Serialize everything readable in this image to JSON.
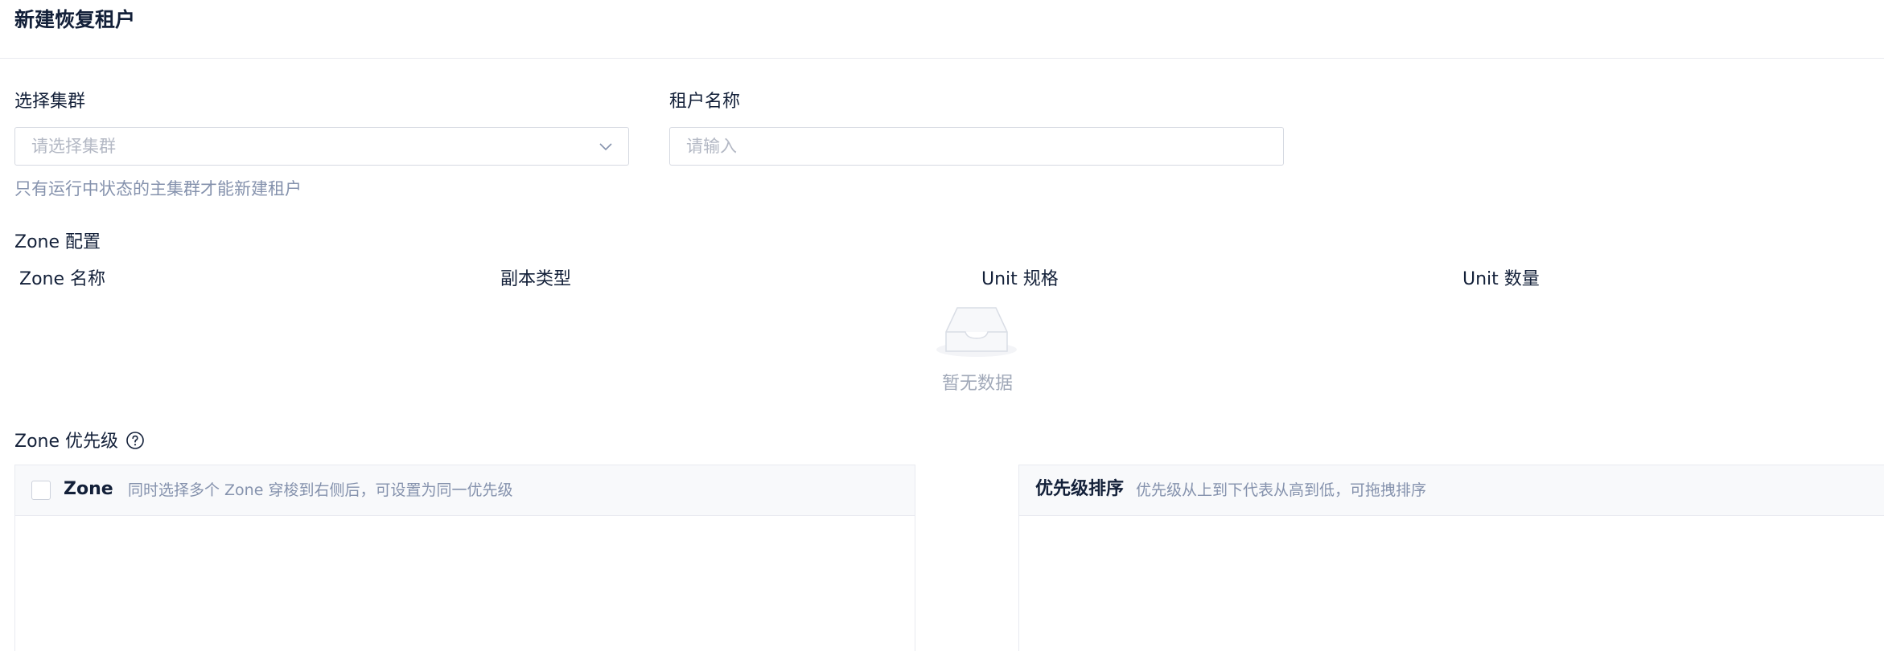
{
  "page": {
    "title": "新建恢复租户"
  },
  "form": {
    "cluster": {
      "label": "选择集群",
      "placeholder": "请选择集群",
      "help": "只有运行中状态的主集群才能新建租户"
    },
    "tenant_name": {
      "label": "租户名称",
      "placeholder": "请输入"
    }
  },
  "zone_config": {
    "label": "Zone 配置",
    "columns": [
      "Zone 名称",
      "副本类型",
      "Unit 规格",
      "Unit 数量"
    ],
    "empty_text": "暂无数据"
  },
  "zone_priority": {
    "label": "Zone 优先级",
    "left_panel": {
      "title": "Zone",
      "hint": "同时选择多个 Zone 穿梭到右侧后，可设置为同一优先级"
    },
    "right_panel": {
      "title": "优先级排序",
      "hint": "优先级从上到下代表从高到低，可拖拽排序"
    }
  },
  "icons": {
    "select_arrow": "chevron-down-icon",
    "empty": "empty-inbox-icon",
    "help": "question-circle-icon"
  }
}
